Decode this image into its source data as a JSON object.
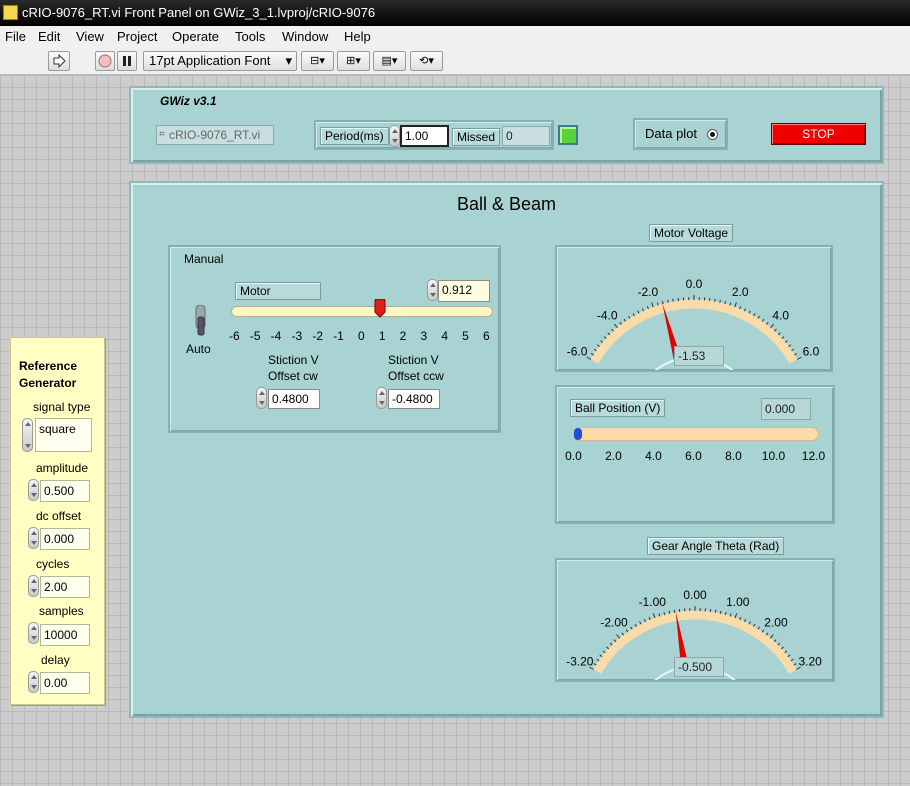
{
  "window": {
    "title": "cRIO-9076_RT.vi Front Panel on GWiz_3_1.lvproj/cRIO-9076"
  },
  "menu": [
    "File",
    "Edit",
    "View",
    "Project",
    "Operate",
    "Tools",
    "Window",
    "Help"
  ],
  "toolbar": {
    "font": "17pt Application Font",
    "run_icon": "run-arrow-icon",
    "abort_icon": "abort-icon",
    "pause_icon": "pause-icon"
  },
  "header_panel": {
    "title": "GWiz v3.1",
    "target": "cRIO-9076_RT.vi",
    "period_label": "Period(ms)",
    "period_value": "1.00",
    "missed_label": "Missed",
    "missed_value": "0",
    "data_plot_label": "Data plot",
    "stop_label": "STOP"
  },
  "main_panel": {
    "title": "Ball & Beam",
    "manual": {
      "label": "Manual",
      "auto_label": "Auto",
      "motor_label": "Motor",
      "motor_value": "0.912",
      "motor_slider_fraction": 0.576,
      "slider_ticks": [
        "-6",
        "-5",
        "-4",
        "-3",
        "-2",
        "-1",
        "0",
        "1",
        "2",
        "3",
        "4",
        "5",
        "6"
      ],
      "stiction_cw_label_1": "Stiction V",
      "stiction_cw_label_2": "Offset cw",
      "stiction_cw_value": "0.4800",
      "stiction_ccw_label_1": "Stiction V",
      "stiction_ccw_label_2": "Offset ccw",
      "stiction_ccw_value": "-0.4800"
    },
    "motor_voltage": {
      "label": "Motor Voltage",
      "ticks": [
        "-6.0",
        "-4.0",
        "-2.0",
        "0.0",
        "2.0",
        "4.0",
        "6.0"
      ],
      "value": "-1.53",
      "value_num": -1.53
    },
    "ball_position": {
      "label": "Ball Position (V)",
      "value": "0.000",
      "fill_fraction": 0.0,
      "ticks": [
        "0.0",
        "2.0",
        "4.0",
        "6.0",
        "8.0",
        "10.0",
        "12.0"
      ]
    },
    "gear_angle": {
      "label": "Gear Angle Theta (Rad)",
      "ticks": [
        "-3.20",
        "-2.00",
        "-1.00",
        "0.00",
        "1.00",
        "2.00",
        "3.20"
      ],
      "value": "-0.500",
      "value_num": -0.5
    }
  },
  "reference_generator": {
    "title_1": "Reference",
    "title_2": "Generator",
    "signal_type_label": "signal type",
    "signal_type_value": "square",
    "amplitude_label": "amplitude",
    "amplitude_value": "0.500",
    "dc_offset_label": "dc offset",
    "dc_offset_value": "0.000",
    "cycles_label": "cycles",
    "cycles_value": "2.00",
    "samples_label": "samples",
    "samples_value": "10000",
    "delay_label": "delay",
    "delay_value": "0.00"
  },
  "colors": {
    "panel": "#a9d3d3",
    "stop": "#f00000",
    "gauge_arc": "#f9dcaa",
    "needle": "#e00000",
    "refgen_bg": "#ffffc4"
  }
}
